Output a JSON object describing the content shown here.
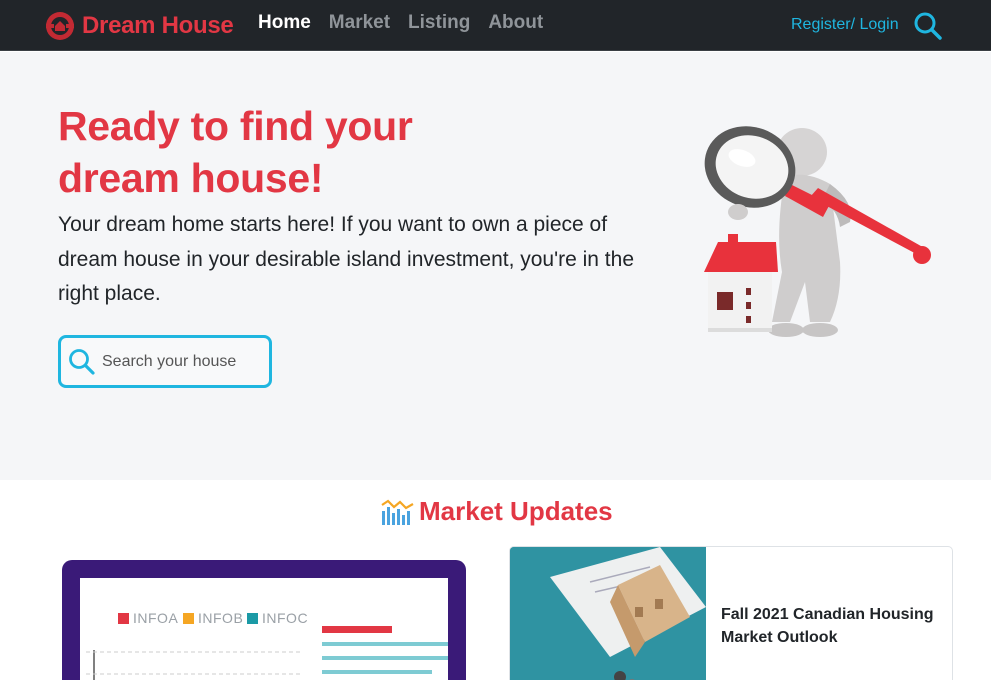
{
  "brand": {
    "name": "Dream House",
    "logo_icon": "brand-logo-icon",
    "color": "#e23744"
  },
  "nav": {
    "items": [
      {
        "label": "Home",
        "active": true
      },
      {
        "label": "Market",
        "active": false
      },
      {
        "label": "Listing",
        "active": false
      },
      {
        "label": "About",
        "active": false
      }
    ],
    "login_label": "Register/ Login",
    "search_icon": "search-icon",
    "accent": "#1fb6e0"
  },
  "hero": {
    "title_line1": "Ready to find your",
    "title_line2": "dream house!",
    "description": "Your dream home starts here! If you want to own a piece of dream house in your desirable island investment, you're in the right place.",
    "search_placeholder": "Search your house",
    "illustration": "magnifier-figure-house-illustration"
  },
  "market": {
    "title": "Market Updates",
    "title_icon": "chart-bars-icon",
    "laptop_legend": [
      "INFOA",
      "INFOB",
      "INFOC"
    ],
    "legend_colors": [
      "#e23744",
      "#f5a623",
      "#1b9aa6"
    ],
    "card_title": "Fall 2021 Canadian Housing Market Outlook"
  }
}
